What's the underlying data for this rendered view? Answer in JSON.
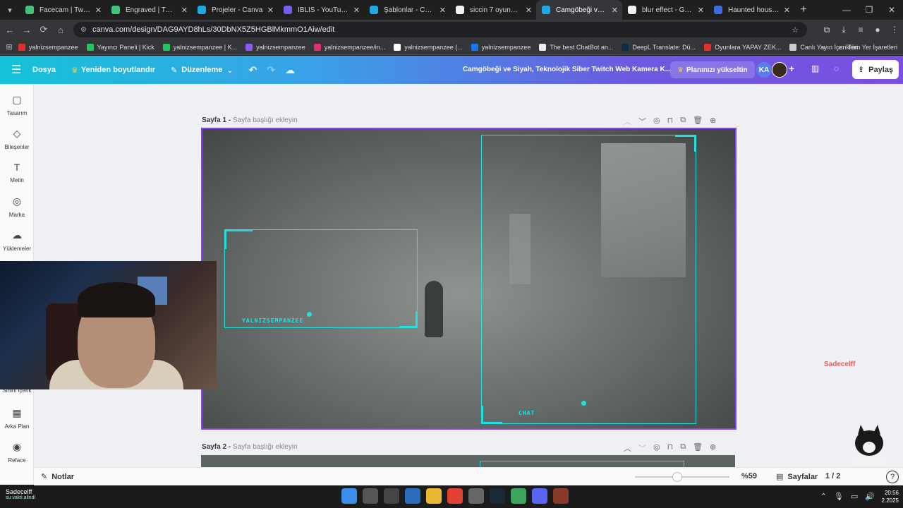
{
  "browser": {
    "tabs": [
      {
        "title": "Facecam | Twitch and",
        "color": "#45c27a"
      },
      {
        "title": "Engraved | Twitch an",
        "color": "#45c27a"
      },
      {
        "title": "Projeler - Canva",
        "color": "#1ea7e0"
      },
      {
        "title": "İBLİS - YouTube Küçü",
        "color": "#7a5cf0"
      },
      {
        "title": "Şablonlar - Canva",
        "color": "#1ea7e0"
      },
      {
        "title": "siccin 7 oyuncuları - G",
        "color": "#f2f2f2"
      },
      {
        "title": "Camgöbeği ve Siyah,",
        "color": "#1ea7e0",
        "active": true
      },
      {
        "title": "blur effect - Google",
        "color": "#f2f2f2"
      },
      {
        "title": "Haunted house in g",
        "color": "#3b6ee0"
      }
    ],
    "url": "canva.com/design/DAG9AYD8hLs/30DbNX5Z5HGBlMkmmO1Aiw/edit",
    "bookmarks": [
      {
        "label": "yalnizsempanzee",
        "color": "#e03030"
      },
      {
        "label": "Yayıncı Paneli | Kick",
        "color": "#22c55e"
      },
      {
        "label": "yalnizsempanzee | K...",
        "color": "#22c55e"
      },
      {
        "label": "yalnizsempanzee",
        "color": "#8b5cf6"
      },
      {
        "label": "yalnizsempanzee/in...",
        "color": "#e1306c"
      },
      {
        "label": "yalnizsempanzee (...",
        "color": "#ffffff"
      },
      {
        "label": "yalnizsempanzee",
        "color": "#1877f2"
      },
      {
        "label": "The best ChatBot an...",
        "color": "#eeeeee"
      },
      {
        "label": "DeepL Translate: Dü...",
        "color": "#0f2b46"
      },
      {
        "label": "Oyunlara YAPAY ZEK...",
        "color": "#e03030"
      },
      {
        "label": "Canlı Yayın İçerikleri",
        "color": "#cccccc"
      }
    ],
    "bookmarks_all": "Tüm Yer İşaretleri"
  },
  "canva": {
    "header": {
      "file": "Dosya",
      "resize": "Yeniden boyutlandır",
      "edit": "Düzenleme",
      "title": "Camgöbeği ve Siyah, Teknolojik Siber Twitch Web Kamera K...",
      "upgrade": "Planınızı yükseltin",
      "avatar_initials": "KA",
      "share": "Paylaş"
    },
    "rail": [
      {
        "label": "Tasarım",
        "icon": "▢"
      },
      {
        "label": "Bileşenler",
        "icon": "◇"
      },
      {
        "label": "Metin",
        "icon": "T"
      },
      {
        "label": "Marka",
        "icon": "◎"
      },
      {
        "label": "Yüklemeler",
        "icon": "☁"
      },
      {
        "label": "Sihirli İçerik",
        "icon": "✦"
      },
      {
        "label": "Arka Plan",
        "icon": "▦"
      },
      {
        "label": "Reface",
        "icon": "◉"
      }
    ],
    "pages": [
      {
        "label": "Sayfa 1 -",
        "title_placeholder": "Sayfa başlığı ekleyin"
      },
      {
        "label": "Sayfa 2 -",
        "title_placeholder": "Sayfa başlığı ekleyin"
      }
    ],
    "design": {
      "frame1_label": "YALNIZSEMPANZEE",
      "frame2_label": "CHAT",
      "accent": "#22e0e0"
    },
    "bottom": {
      "notes": "Notlar",
      "zoom": "%59",
      "zoom_fraction": 0.45,
      "pages": "Sayfalar",
      "page_count": "1 / 2",
      "help": "?"
    }
  },
  "overlay": {
    "watermark": "Sadecelff"
  },
  "taskbar": {
    "weather_title": "Sadecelff",
    "weather_sub": "su vakti alindi",
    "time": "20:56",
    "date": "2.2025"
  }
}
